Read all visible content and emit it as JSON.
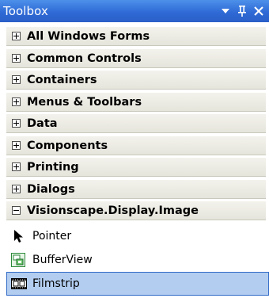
{
  "window": {
    "title": "Toolbox"
  },
  "titlebar_icons": [
    "chevron-down-icon",
    "pin-icon",
    "close-icon"
  ],
  "categories": [
    {
      "label": "All Windows Forms",
      "state": "collapsed"
    },
    {
      "label": "Common Controls",
      "state": "collapsed"
    },
    {
      "label": "Containers",
      "state": "collapsed"
    },
    {
      "label": "Menus & Toolbars",
      "state": "collapsed"
    },
    {
      "label": "Data",
      "state": "collapsed"
    },
    {
      "label": "Components",
      "state": "collapsed"
    },
    {
      "label": "Printing",
      "state": "collapsed"
    },
    {
      "label": "Dialogs",
      "state": "collapsed"
    },
    {
      "label": "Visionscape.Display.Image",
      "state": "expanded"
    }
  ],
  "items": [
    {
      "label": "Pointer",
      "icon": "pointer-arrow-icon",
      "selected": false
    },
    {
      "label": "BufferView",
      "icon": "bufferview-icon",
      "selected": false
    },
    {
      "label": "Filmstrip",
      "icon": "filmstrip-icon",
      "selected": true
    }
  ],
  "colors": {
    "titlebar": "#2f6ad6",
    "selection": "#b3cdf0",
    "selection_border": "#316ac5",
    "category_bg": "#ece9d8"
  }
}
